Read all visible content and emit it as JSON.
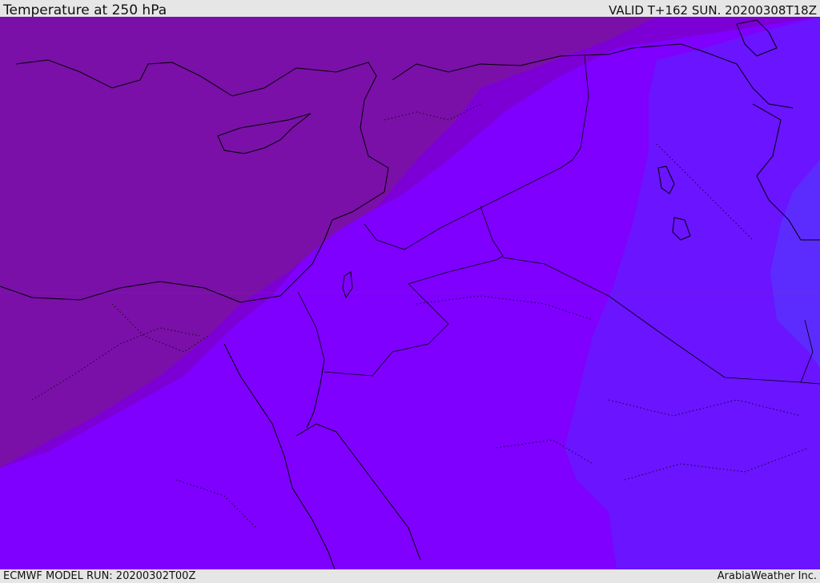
{
  "header": {
    "title": "Temperature at 250 hPa",
    "valid": "VALID T+162 SUN. 20200308T18Z"
  },
  "footer": {
    "model_run": "ECMWF MODEL RUN: 20200302T00Z",
    "credit": "ArabiaWeather Inc."
  },
  "colors": {
    "band_coldest": "#7a10a8",
    "band_cold": "#7c00d6",
    "band_mid": "#7f00ff",
    "band_warm": "#6a14ff",
    "band_warmest": "#5c2cff",
    "coast": "#000000"
  }
}
